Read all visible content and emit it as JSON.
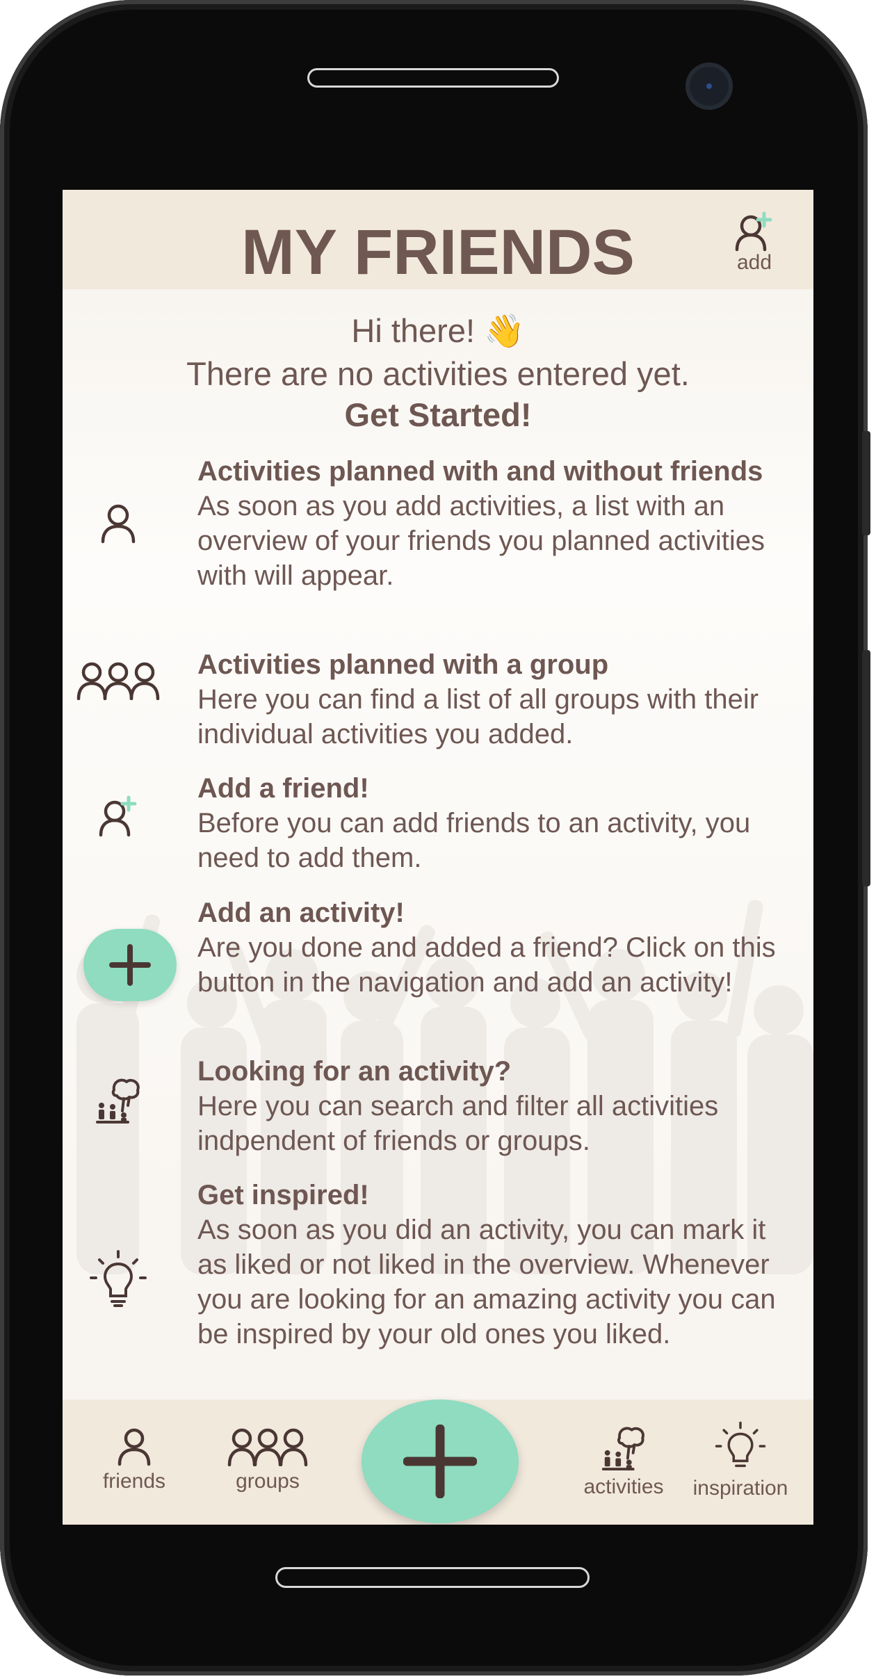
{
  "header": {
    "title": "MY FRIENDS",
    "add_label": "add"
  },
  "intro": {
    "greeting": "Hi there! 👋",
    "message": "There are no activities entered yet.",
    "cta": "Get Started!"
  },
  "items": [
    {
      "icon": "person-icon",
      "title": "Activities planned with and without friends",
      "body": "As soon as you add activities, a list with an overview of your friends you planned activities with will appear."
    },
    {
      "icon": "group-icon",
      "title": "Activities planned with a group",
      "body": "Here you can find a list of all groups with their individual activities you added."
    },
    {
      "icon": "add-friend-icon",
      "title": "Add a friend!",
      "body": "Before you can add friends to an activity, you need to add them."
    },
    {
      "icon": "plus-icon",
      "title": "Add an activity!",
      "body": "Are you done and added a friend? Click on this button in the navigation and add an activity!"
    },
    {
      "icon": "activities-icon",
      "title": "Looking for an activity?",
      "body": "Here you can search and filter all activities indpendent of friends or groups."
    },
    {
      "icon": "lightbulb-icon",
      "title": "Get inspired!",
      "body": "As soon as you did an activity, you can mark it as liked or not liked in the overview. Whenever you are looking for an amazing activity you can be inspired by your old ones you liked."
    }
  ],
  "nav": {
    "friends": "friends",
    "groups": "groups",
    "activities": "activities",
    "inspiration": "inspiration"
  },
  "colors": {
    "accent": "#8fdcc0",
    "text": "#6f5852",
    "header_bg": "#f2e9dd",
    "icon": "#4a3733"
  }
}
